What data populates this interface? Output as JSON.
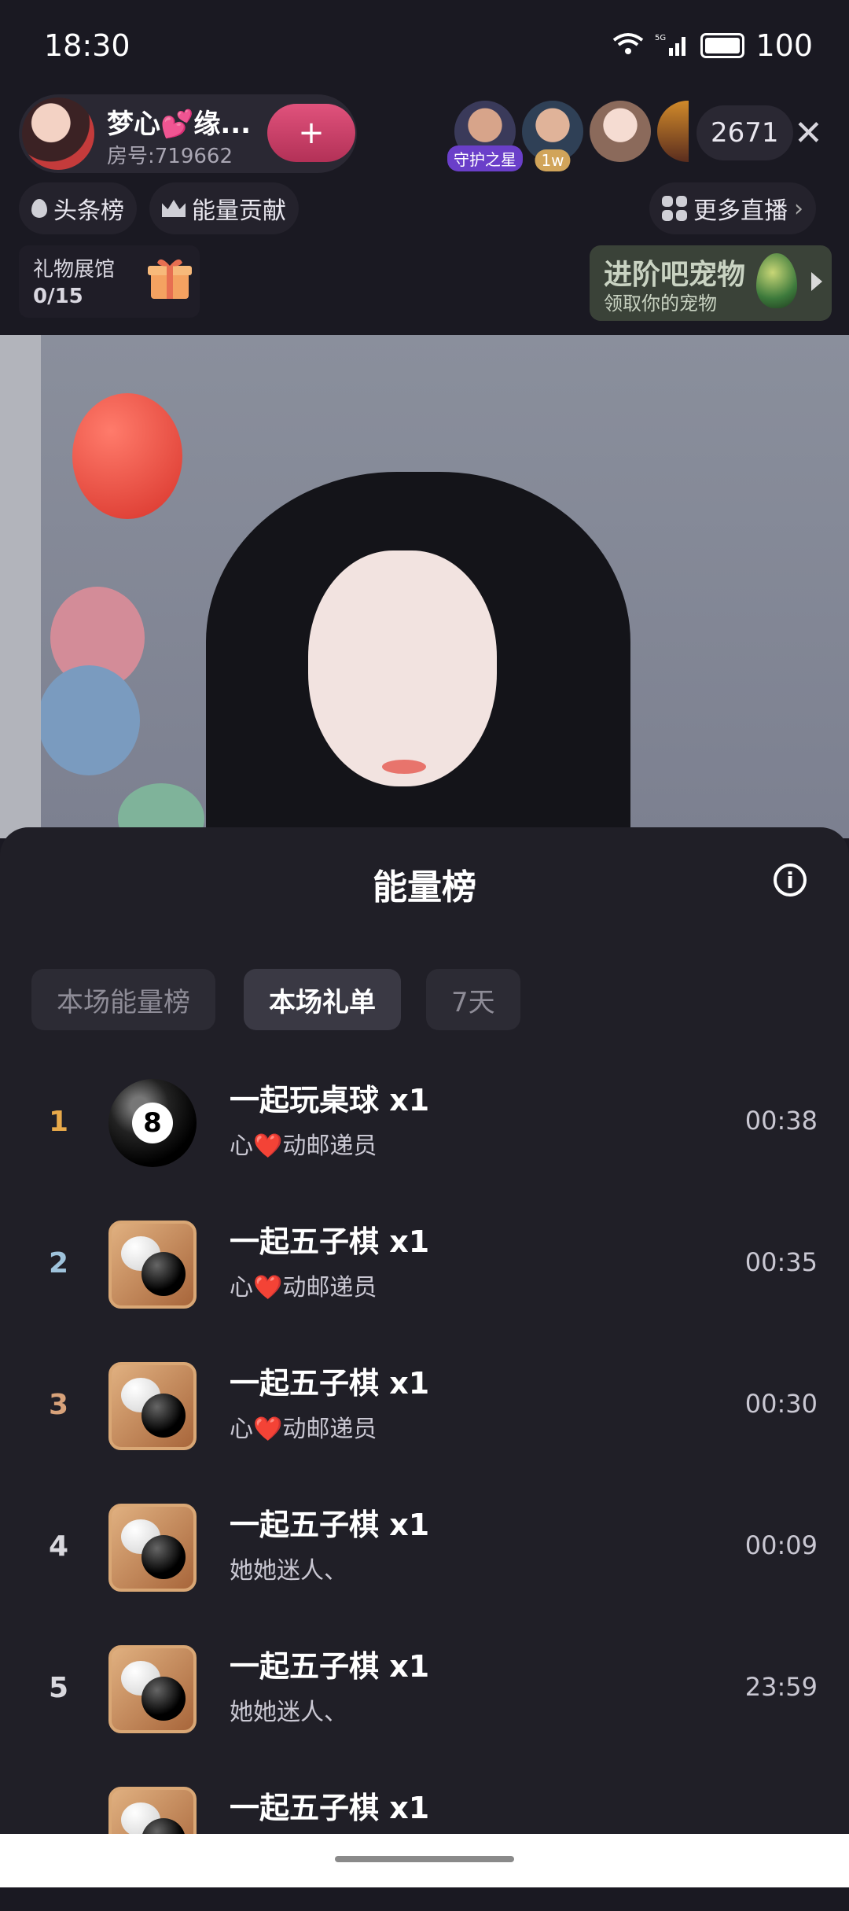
{
  "status_bar": {
    "time": "18:30",
    "network": "5G",
    "battery": "100"
  },
  "host": {
    "name": "梦心💕缘...",
    "room_no": "房号:719662",
    "follow_label": "+"
  },
  "viewers": {
    "badge1": "守护之星",
    "badge2": "1w",
    "count": "2671"
  },
  "tabs_top": {
    "headline": "头条榜",
    "energy": "能量贡献",
    "more_live": "更多直播"
  },
  "museum": {
    "title": "礼物展馆",
    "count": "0/15"
  },
  "pet": {
    "title": "进阶吧宠物",
    "subtitle": "领取你的宠物"
  },
  "sheet": {
    "title": "能量榜",
    "tabs": [
      {
        "label": "本场能量榜",
        "active": false
      },
      {
        "label": "本场礼单",
        "active": true
      },
      {
        "label": "7天",
        "active": false
      }
    ],
    "rows": [
      {
        "rank": "1",
        "rank_color": "#e8a94a",
        "gift": "一起玩桌球  x1",
        "gift_icon": "billiard-ball-icon",
        "user": "心❤️动邮递员",
        "time": "00:38"
      },
      {
        "rank": "2",
        "rank_color": "#9fc3dc",
        "gift": "一起五子棋  x1",
        "gift_icon": "gomoku-icon",
        "user": "心❤️动邮递员",
        "time": "00:35"
      },
      {
        "rank": "3",
        "rank_color": "#d8a27a",
        "gift": "一起五子棋  x1",
        "gift_icon": "gomoku-icon",
        "user": "心❤️动邮递员",
        "time": "00:30"
      },
      {
        "rank": "4",
        "rank_color": "#d9d8de",
        "gift": "一起五子棋  x1",
        "gift_icon": "gomoku-icon",
        "user": "她她迷人、",
        "time": "00:09"
      },
      {
        "rank": "5",
        "rank_color": "#d9d8de",
        "gift": "一起五子棋  x1",
        "gift_icon": "gomoku-icon",
        "user": "她她迷人、",
        "time": "23:59"
      },
      {
        "rank": "",
        "rank_color": "#d9d8de",
        "gift": "一起五子棋  x1",
        "gift_icon": "gomoku-icon",
        "user": "",
        "time": ""
      }
    ]
  }
}
